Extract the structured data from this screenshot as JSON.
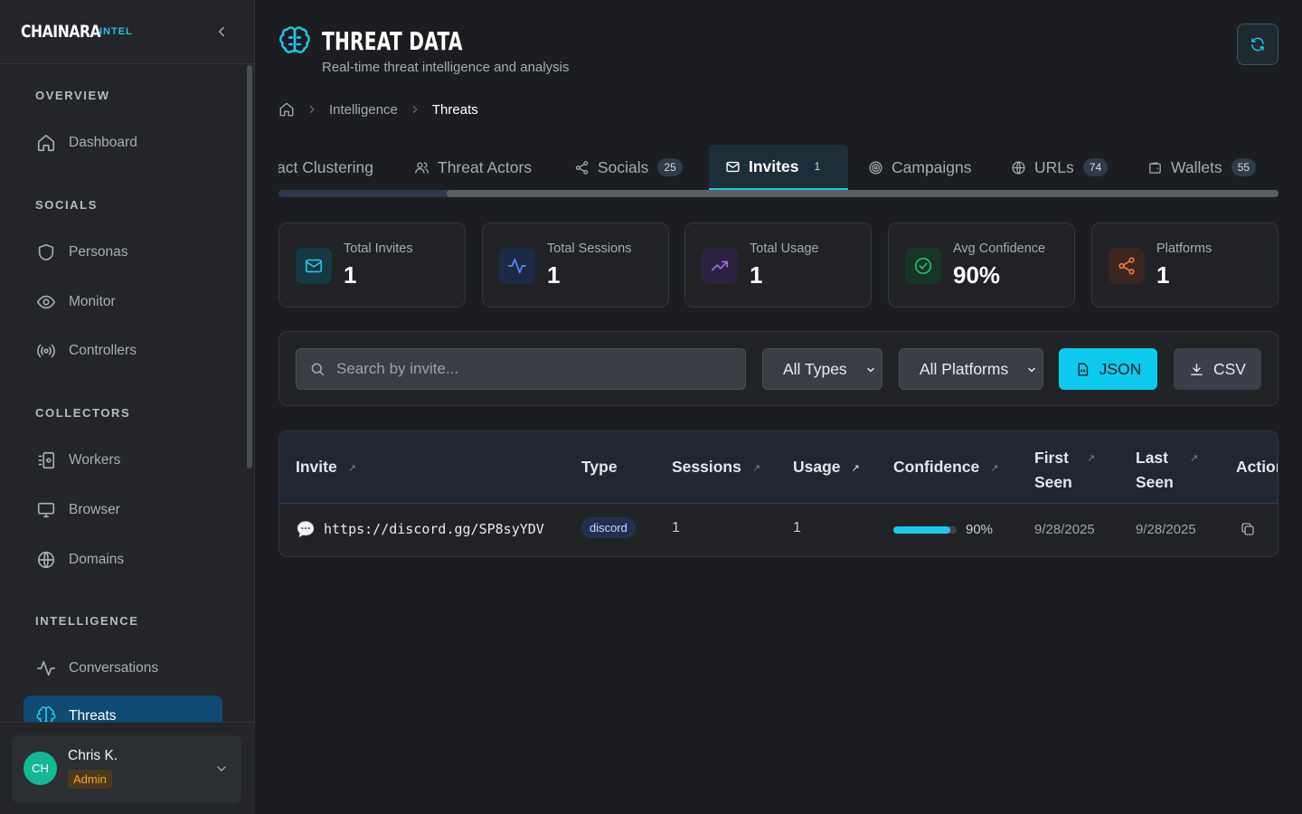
{
  "brand": {
    "name": "CHAINARA",
    "sub": "INTEL"
  },
  "sidebar": {
    "sections": [
      {
        "label": "OVERVIEW"
      },
      {
        "label": "SOCIALS"
      },
      {
        "label": "COLLECTORS"
      },
      {
        "label": "INTELLIGENCE"
      }
    ],
    "items": [
      {
        "label": "Dashboard",
        "icon": "home-icon"
      },
      {
        "label": "Personas",
        "icon": "shield-icon"
      },
      {
        "label": "Monitor",
        "icon": "eye-icon"
      },
      {
        "label": "Controllers",
        "icon": "broadcast-icon"
      },
      {
        "label": "Workers",
        "icon": "workers-icon"
      },
      {
        "label": "Browser",
        "icon": "monitor-icon"
      },
      {
        "label": "Domains",
        "icon": "globe-icon"
      },
      {
        "label": "Conversations",
        "icon": "activity-icon"
      },
      {
        "label": "Threats",
        "icon": "brain-icon",
        "active": true
      }
    ]
  },
  "user": {
    "initials": "CH",
    "name": "Chris K.",
    "role": "Admin"
  },
  "header": {
    "title": "THREAT DATA",
    "subtitle": "Real-time threat intelligence and analysis"
  },
  "breadcrumb": {
    "items": [
      "Intelligence",
      "Threats"
    ]
  },
  "tabs": [
    {
      "label": "act Clustering"
    },
    {
      "label": "Threat Actors",
      "icon": "users-icon"
    },
    {
      "label": "Socials",
      "badge": "25",
      "icon": "share-icon"
    },
    {
      "label": "Invites",
      "badge": "1",
      "icon": "mail-icon",
      "active": true
    },
    {
      "label": "Campaigns",
      "icon": "target-icon"
    },
    {
      "label": "URLs",
      "badge": "74",
      "icon": "globe-icon"
    },
    {
      "label": "Wallets",
      "badge": "55",
      "icon": "wallet-icon"
    }
  ],
  "stats": [
    {
      "label": "Total Invites",
      "value": "1",
      "color": "#22c6e8"
    },
    {
      "label": "Total Sessions",
      "value": "1",
      "color": "#4f8cff"
    },
    {
      "label": "Total Usage",
      "value": "1",
      "color": "#a46cf5"
    },
    {
      "label": "Avg Confidence",
      "value": "90%",
      "color": "#22c55e"
    },
    {
      "label": "Platforms",
      "value": "1",
      "color": "#f27a3a"
    }
  ],
  "filters": {
    "search_placeholder": "Search by invite...",
    "type_select": "All Types",
    "platform_select": "All Platforms",
    "json_label": "JSON",
    "csv_label": "CSV"
  },
  "table": {
    "columns": {
      "invite": "Invite",
      "type": "Type",
      "sessions": "Sessions",
      "usage": "Usage",
      "confidence": "Confidence",
      "first_seen_1": "First",
      "first_seen_2": "Seen",
      "last_seen_1": "Last",
      "last_seen_2": "Seen",
      "actions": "Actions"
    },
    "rows": [
      {
        "invite": "https://discord.gg/SP8syYDV",
        "type": "discord",
        "sessions": "1",
        "usage": "1",
        "confidence_text": "90%",
        "confidence": 0.9,
        "first_seen": "9/28/2025",
        "last_seen": "9/28/2025"
      }
    ]
  }
}
